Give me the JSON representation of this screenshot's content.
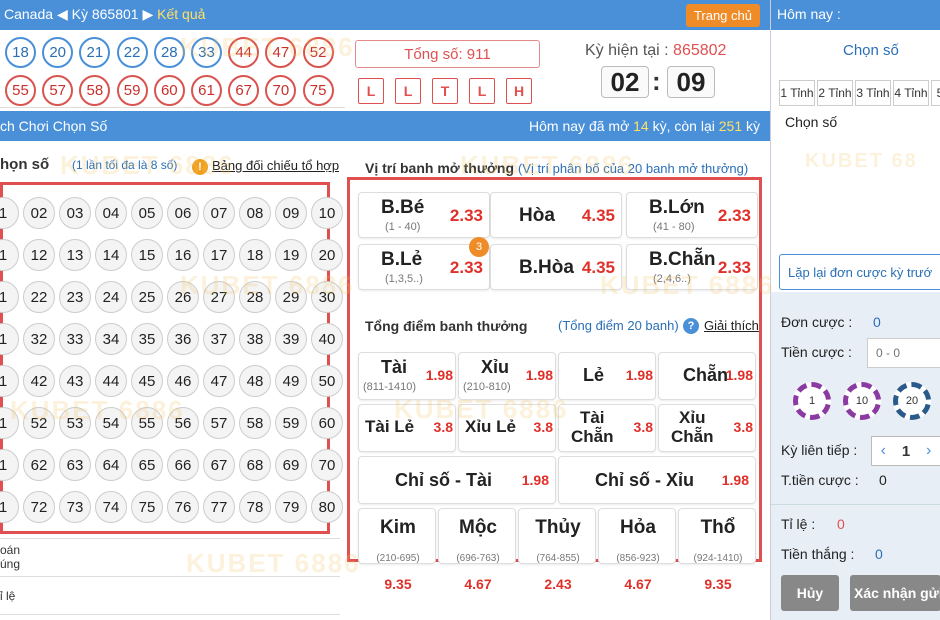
{
  "header": {
    "country": "Canada",
    "period_label": "Kỳ 865801",
    "result_label": "Kết quả",
    "home_button": "Trang chủ"
  },
  "result_balls": {
    "row1": [
      "18",
      "20",
      "21",
      "22",
      "28",
      "33",
      "44",
      "47",
      "52"
    ],
    "row2": [
      "55",
      "57",
      "58",
      "59",
      "60",
      "61",
      "67",
      "70",
      "75"
    ]
  },
  "summary": {
    "total": "Tổng số: 911",
    "letters": [
      "L",
      "L",
      "T",
      "L",
      "H"
    ],
    "current_label": "Kỳ hiện tại : ",
    "current_num": "865802",
    "timer_min": "02",
    "timer_sec": "09"
  },
  "bluebar": {
    "left": "ch Chơi Chọn Số",
    "right_pre": "Hôm nay đã mở ",
    "opened": "14",
    "right_mid": " kỳ, còn lại ",
    "remaining": "251",
    "right_post": " kỳ"
  },
  "pick": {
    "title": "họn số",
    "hint": "(1 lần tối đa là 8 số)",
    "info_icon": "!",
    "link": "Bảng đối chiếu tổ hợp",
    "numbers": [
      [
        "1",
        "02",
        "03",
        "04",
        "05",
        "06",
        "07",
        "08",
        "09",
        "10"
      ],
      [
        "1",
        "12",
        "13",
        "14",
        "15",
        "16",
        "17",
        "18",
        "19",
        "20"
      ],
      [
        "1",
        "22",
        "23",
        "24",
        "25",
        "26",
        "27",
        "28",
        "29",
        "30"
      ],
      [
        "1",
        "32",
        "33",
        "34",
        "35",
        "36",
        "37",
        "38",
        "39",
        "40"
      ],
      [
        "1",
        "42",
        "43",
        "44",
        "45",
        "46",
        "47",
        "48",
        "49",
        "50"
      ],
      [
        "1",
        "52",
        "53",
        "54",
        "55",
        "56",
        "57",
        "58",
        "59",
        "60"
      ],
      [
        "1",
        "62",
        "63",
        "64",
        "65",
        "66",
        "67",
        "68",
        "69",
        "70"
      ],
      [
        "1",
        "72",
        "73",
        "74",
        "75",
        "76",
        "77",
        "78",
        "79",
        "80"
      ]
    ],
    "bottom_row1": "oán\núng",
    "bottom_row2": "ỉ lệ"
  },
  "position": {
    "title": "Vị trí banh mở thưởng",
    "note": "(Vị trí phân bố của 20 banh mở thưởng)",
    "badge": "3",
    "cells": [
      {
        "name": "B.Bé",
        "sub": "(1 - 40)",
        "odds": "2.33"
      },
      {
        "name": "Hòa",
        "sub": "",
        "odds": "4.35"
      },
      {
        "name": "B.Lớn",
        "sub": "(41 - 80)",
        "odds": "2.33"
      },
      {
        "name": "B.Lẻ",
        "sub": "(1,3,5..)",
        "odds": "2.33"
      },
      {
        "name": "B.Hòa",
        "sub": "",
        "odds": "4.35"
      },
      {
        "name": "B.Chẵn",
        "sub": "(2,4,6..)",
        "odds": "2.33"
      }
    ]
  },
  "total_points": {
    "title": "Tổng điểm banh thưởng",
    "note": "(Tổng điểm 20 banh)",
    "q_icon": "?",
    "link": "Giải thích",
    "row1": [
      {
        "name": "Tài",
        "sub": "(811-1410)",
        "odds": "1.98"
      },
      {
        "name": "Xỉu",
        "sub": "(210-810)",
        "odds": "1.98"
      },
      {
        "name": "Lẻ",
        "sub": "",
        "odds": "1.98"
      },
      {
        "name": "Chẵn",
        "sub": "",
        "odds": "1.98"
      }
    ],
    "row2": [
      {
        "name": "Tài Lẻ",
        "odds": "3.8"
      },
      {
        "name": "Xỉu Lẻ",
        "odds": "3.8"
      },
      {
        "name": "Tài\nChẵn",
        "odds": "3.8"
      },
      {
        "name": "Xỉu\nChẵn",
        "odds": "3.8"
      }
    ],
    "row3": [
      {
        "name": "Chỉ số - Tài",
        "odds": "1.98"
      },
      {
        "name": "Chỉ số - Xỉu",
        "odds": "1.98"
      }
    ],
    "elements": [
      {
        "name": "Kim",
        "sub": "(210-695)",
        "odds": "9.35"
      },
      {
        "name": "Mộc",
        "sub": "(696-763)",
        "odds": "4.67"
      },
      {
        "name": "Thủy",
        "sub": "(764-855)",
        "odds": "2.43"
      },
      {
        "name": "Hỏa",
        "sub": "(856-923)",
        "odds": "4.67"
      },
      {
        "name": "Thổ",
        "sub": "(924-1410)",
        "odds": "9.35"
      }
    ]
  },
  "sidebar": {
    "today": "Hôm nay :",
    "choose": "Chọn số",
    "tabs": [
      "1 Tỉnh",
      "2 Tỉnh",
      "3 Tỉnh",
      "4 Tỉnh",
      "5"
    ],
    "choose2": "Chọn số",
    "repeat": "Lặp lại đơn cược kỳ trướ",
    "don_cuoc_label": "Đơn cược :",
    "don_cuoc_val": "0",
    "tien_cuoc_label": "Tiền cược :",
    "tien_cuoc_ph": "0 - 0",
    "chips": [
      "1",
      "10",
      "20"
    ],
    "ky_lien_tiep": "Kỳ liên tiếp :",
    "stepper_val": "1",
    "ttien_label": "T.tiền cược :",
    "ttien_val": "0",
    "tile_label": "Tỉ lệ :",
    "tile_val": "0",
    "tienthang_label": "Tiền thắng :",
    "tienthang_val": "0",
    "cancel": "Hủy",
    "confirm": "Xác nhận gửi",
    "watermark": "KUBET 68"
  },
  "colors": {
    "primary": "#4a90d9",
    "accent": "#e05050",
    "orange": "#f08c28"
  },
  "watermark": "KUBET 6886"
}
